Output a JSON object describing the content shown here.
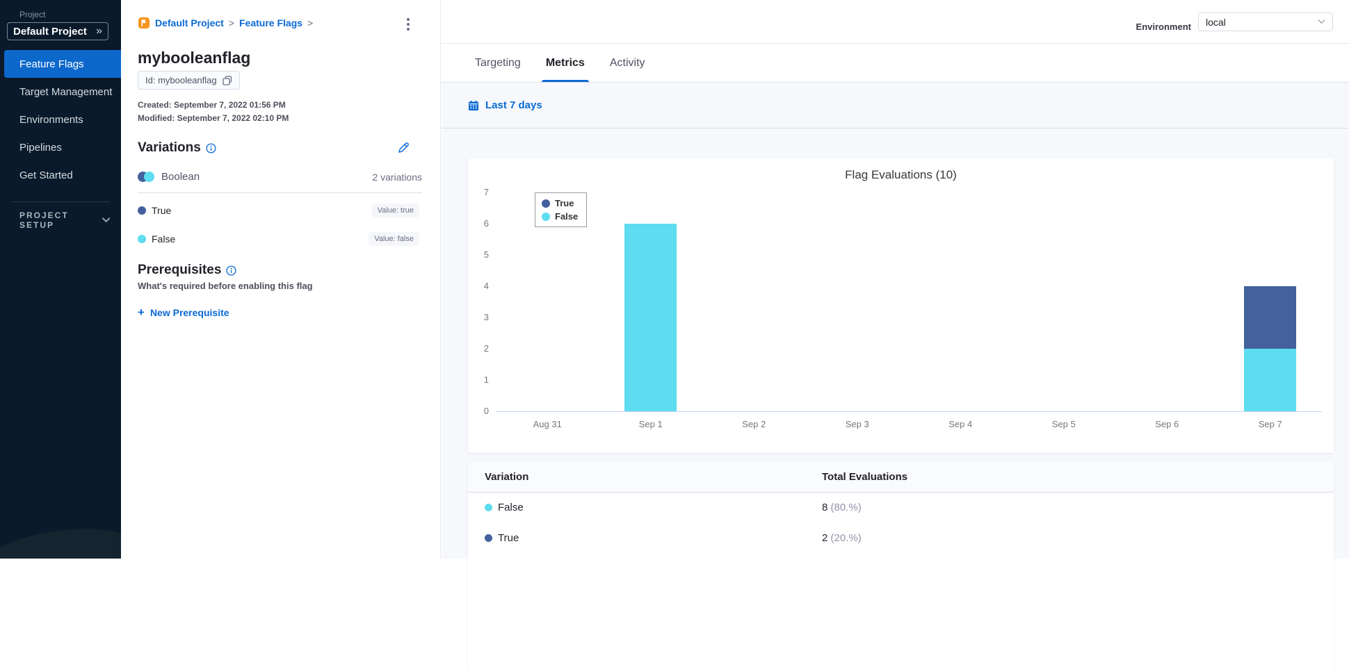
{
  "colors": {
    "primary_blue": "#0b6ad4",
    "true_blue": "#44619d",
    "false_cyan": "#5edcf0",
    "sidebar_bg": "#0a1a2b",
    "active_nav_bg": "#0d68cc"
  },
  "sidebar": {
    "project_label": "Project",
    "project_selector": {
      "value": "Default Project",
      "expand_glyph": "»"
    },
    "items": [
      {
        "label": "Feature Flags",
        "active": true
      },
      {
        "label": "Target Management",
        "active": false
      },
      {
        "label": "Environments",
        "active": false
      },
      {
        "label": "Pipelines",
        "active": false
      },
      {
        "label": "Get Started",
        "active": false
      }
    ],
    "section_label": "PROJECT SETUP"
  },
  "breadcrumb": {
    "items": [
      "Default Project",
      "Feature Flags"
    ],
    "separator": ">"
  },
  "environment": {
    "label": "Environment",
    "selected": "local"
  },
  "flag": {
    "name": "mybooleanflag",
    "id_pill": "Id: mybooleanflag",
    "created": "Created: September 7, 2022 01:56 PM",
    "modified": "Modified: September 7, 2022 02:10 PM"
  },
  "variations": {
    "heading": "Variations",
    "type_label": "Boolean",
    "count_label": "2 variations",
    "items": [
      {
        "name": "True",
        "value_label": "Value: true",
        "color": "#44619d"
      },
      {
        "name": "False",
        "value_label": "Value: false",
        "color": "#5edcf0"
      }
    ]
  },
  "prerequisites": {
    "heading": "Prerequisites",
    "description": "What's required before enabling this flag",
    "add_icon": "+",
    "add_label": "New Prerequisite"
  },
  "tabs": {
    "items": [
      "Targeting",
      "Metrics",
      "Activity"
    ],
    "active": "Metrics"
  },
  "date_filter": {
    "label": "Last 7 days"
  },
  "chart_data": {
    "type": "bar",
    "stacked": true,
    "title": "Flag Evaluations (10)",
    "categories": [
      "Aug 31",
      "Sep 1",
      "Sep 2",
      "Sep 3",
      "Sep 4",
      "Sep 5",
      "Sep 6",
      "Sep 7"
    ],
    "series": [
      {
        "name": "True",
        "color": "#44619d",
        "values": [
          0,
          0,
          0,
          0,
          0,
          0,
          0,
          2
        ]
      },
      {
        "name": "False",
        "color": "#5edcf0",
        "values": [
          0,
          6,
          0,
          0,
          0,
          0,
          0,
          2
        ]
      }
    ],
    "ylim": [
      0,
      7
    ],
    "yticks": [
      0,
      1,
      2,
      3,
      4,
      5,
      6,
      7
    ],
    "xlabel": "",
    "ylabel": "",
    "grid": false,
    "legend_position": "top-left"
  },
  "evaluations_table": {
    "headers": [
      "Variation",
      "Total Evaluations"
    ],
    "rows": [
      {
        "name": "False",
        "color": "#5edcf0",
        "count": "8",
        "percent": "(80.%)"
      },
      {
        "name": "True",
        "color": "#44619d",
        "count": "2",
        "percent": "(20.%)"
      }
    ]
  }
}
